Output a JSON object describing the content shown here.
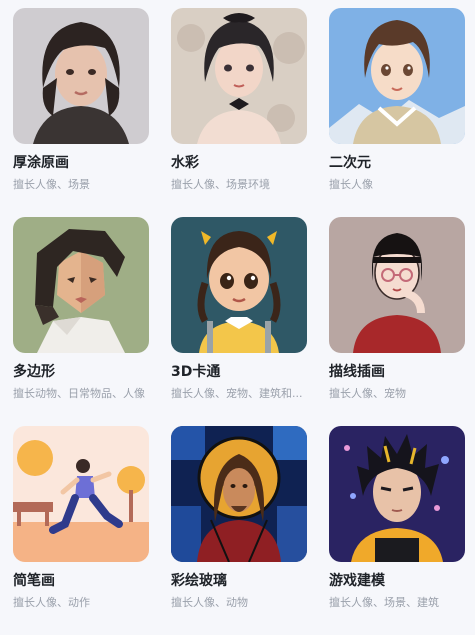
{
  "styles": [
    {
      "title": "厚涂原画",
      "desc": "擅长人像、场景"
    },
    {
      "title": "水彩",
      "desc": "擅长人像、场景环境"
    },
    {
      "title": "二次元",
      "desc": "擅长人像"
    },
    {
      "title": "多边形",
      "desc": "擅长动物、日常物品、人像"
    },
    {
      "title": "3D卡通",
      "desc": "擅长人像、宠物、建筑和..."
    },
    {
      "title": "描线插画",
      "desc": "擅长人像、宠物"
    },
    {
      "title": "简笔画",
      "desc": "擅长人像、动作"
    },
    {
      "title": "彩绘玻璃",
      "desc": "擅长人像、动物"
    },
    {
      "title": "游戏建模",
      "desc": "擅长人像、场景、建筑"
    }
  ]
}
